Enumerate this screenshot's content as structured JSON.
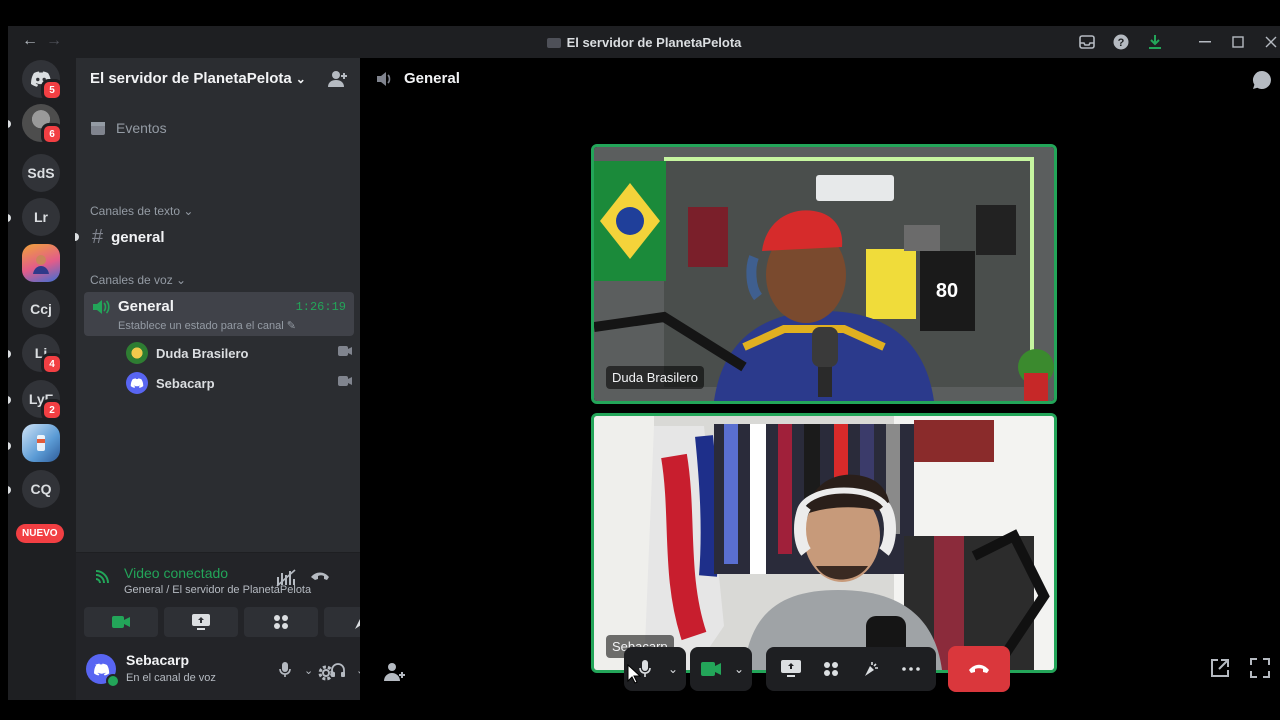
{
  "window": {
    "title": "El servidor de PlanetaPelota",
    "back_icon": "arrow-left-icon",
    "forward_icon": "arrow-right-icon"
  },
  "rail": {
    "servers": [
      {
        "label": "",
        "kind": "discord-home",
        "badge": "5"
      },
      {
        "label": "",
        "kind": "avatar",
        "badge": "6"
      },
      {
        "label": "SdS",
        "badge": ""
      },
      {
        "label": "Lr",
        "badge": ""
      },
      {
        "label": "",
        "kind": "avatar",
        "badge": ""
      },
      {
        "label": "Ccj",
        "badge": ""
      },
      {
        "label": "Li",
        "badge": "4"
      },
      {
        "label": "LyF",
        "badge": "2"
      },
      {
        "label": "",
        "kind": "avatar",
        "badge": ""
      },
      {
        "label": "CQ",
        "badge": ""
      }
    ],
    "new_badge": "NUEVO"
  },
  "sidebar": {
    "server_name": "El servidor de PlanetaPelota",
    "events_label": "Eventos",
    "text_category": "Canales de texto",
    "text_channel": "general",
    "voice_category": "Canales de voz",
    "voice_channel": {
      "name": "General",
      "duration": "1:26:19",
      "status_placeholder": "Establece un estado para el canal",
      "users": [
        "Duda Brasilero",
        "Sebacarp"
      ]
    }
  },
  "voice_panel": {
    "title": "Video conectado",
    "subtitle": "General / El servidor de PlanetaPelota"
  },
  "user": {
    "name": "Sebacarp",
    "status": "En el canal de voz"
  },
  "main": {
    "channel_name": "General",
    "participants": [
      {
        "name": "Duda Brasilero"
      },
      {
        "name": "Sebacarp"
      }
    ]
  },
  "colors": {
    "accent_green": "#23a559",
    "danger_red": "#da373c",
    "blurple": "#5865f2"
  }
}
